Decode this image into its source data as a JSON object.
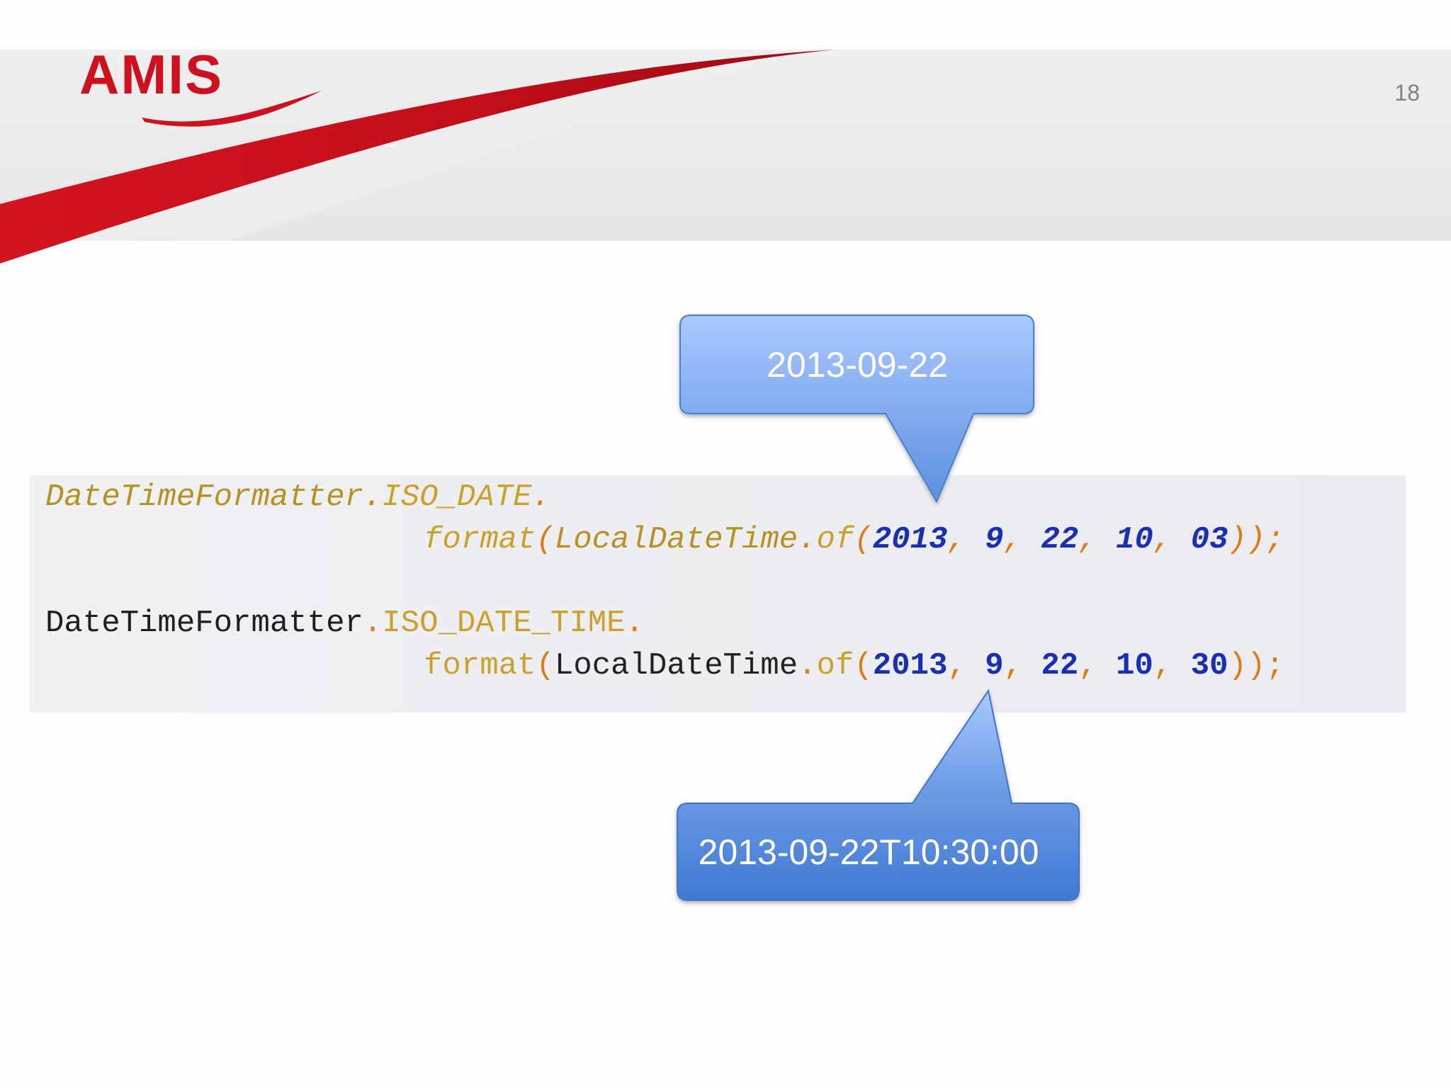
{
  "logo": {
    "text": "AMIS"
  },
  "page_number": "18",
  "colors": {
    "brand_red": "#d0101c",
    "callout_blue": "#5b8fe0",
    "number_blue": "#1a2fb5",
    "keyword_gold": "#c9a227",
    "punct_orange": "#e07b12"
  },
  "code": {
    "line1": {
      "cls": "DateTimeFormatter",
      "dot1": ".",
      "const": "ISO_DATE",
      "dot2": "."
    },
    "line2": {
      "method": "format",
      "paren": "(",
      "cls": "LocalDateTime",
      "dot": ".",
      "of": "of",
      "paren2": "(",
      "n1": "2013",
      "c1": ", ",
      "n2": "9",
      "c2": ", ",
      "n3": "22",
      "c3": ", ",
      "n4": "10",
      "c4": ", ",
      "n5": "03",
      "end": "));"
    },
    "line3": {
      "cls": "DateTimeFormatter",
      "dot1": ".",
      "const": "ISO_DATE_TIME",
      "dot2": "."
    },
    "line4": {
      "method": "format",
      "paren": "(",
      "cls": "LocalDateTime",
      "dot": ".",
      "of": "of",
      "paren2": "(",
      "n1": "2013",
      "c1": ", ",
      "n2": "9",
      "c2": ", ",
      "n3": "22",
      "c3": ", ",
      "n4": "10",
      "c4": ", ",
      "n5": "30",
      "end": "));"
    }
  },
  "callouts": {
    "top": "2013-09-22",
    "bottom": "2013-09-22T10:30:00"
  }
}
